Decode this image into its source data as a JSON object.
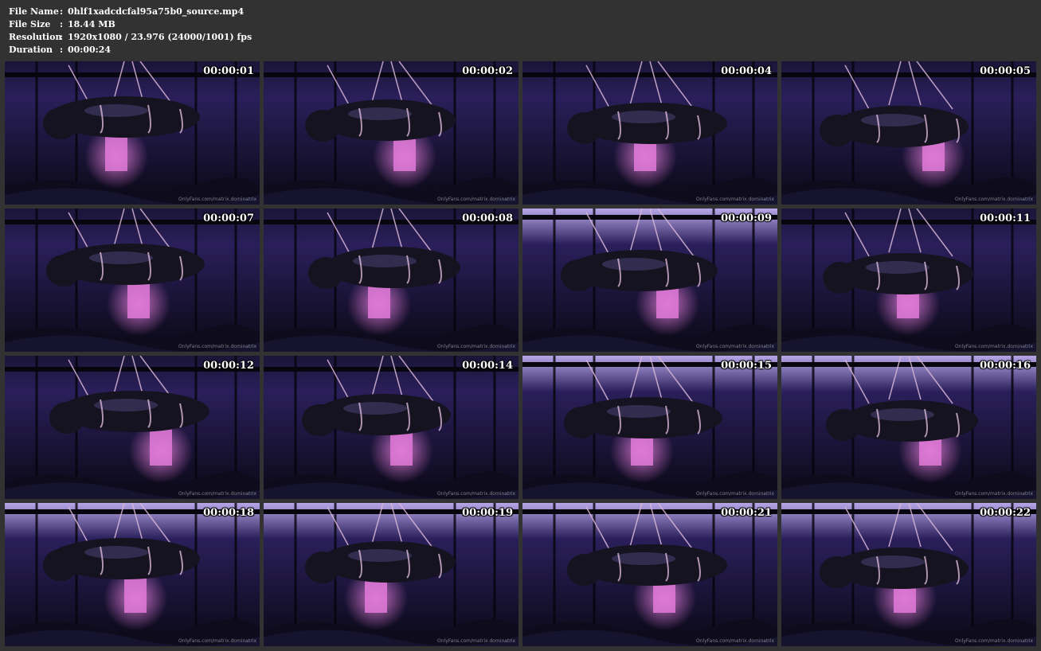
{
  "file_info": {
    "file_name_label": "File Name",
    "file_name_value": "0hlf1xadcdcfal95a75b0_source.mp4",
    "file_size_label": "File Size",
    "file_size_value": "18.44 MB",
    "resolution_label": "Resolution",
    "resolution_value": "1920x1080 / 23.976 (24000/1001) fps",
    "duration_label": "Duration",
    "duration_value": "00:00:24",
    "separator": ":"
  },
  "watermark": "OnlyFans.com/matrix.dominatrix",
  "thumbnails": [
    {
      "timestamp": "00:00:01",
      "variant": "dark"
    },
    {
      "timestamp": "00:00:02",
      "variant": "dark"
    },
    {
      "timestamp": "00:00:04",
      "variant": "dark"
    },
    {
      "timestamp": "00:00:05",
      "variant": "dark"
    },
    {
      "timestamp": "00:00:07",
      "variant": "dark"
    },
    {
      "timestamp": "00:00:08",
      "variant": "dark"
    },
    {
      "timestamp": "00:00:09",
      "variant": "light-top"
    },
    {
      "timestamp": "00:00:11",
      "variant": "dark"
    },
    {
      "timestamp": "00:00:12",
      "variant": "dark"
    },
    {
      "timestamp": "00:00:14",
      "variant": "dark"
    },
    {
      "timestamp": "00:00:15",
      "variant": "light-top"
    },
    {
      "timestamp": "00:00:16",
      "variant": "light-top"
    },
    {
      "timestamp": "00:00:18",
      "variant": "light-top"
    },
    {
      "timestamp": "00:00:19",
      "variant": "light-top"
    },
    {
      "timestamp": "00:00:21",
      "variant": "light-top"
    },
    {
      "timestamp": "00:00:22",
      "variant": "light-top"
    }
  ],
  "colors": {
    "background": "#323232",
    "text": "#ffffff",
    "scene_dark": "#0a0814",
    "scene_purple": "#2a1f5a",
    "scene_pink": "#e07ad8",
    "latex": "#15131f",
    "rope": "#d9b8d8"
  }
}
